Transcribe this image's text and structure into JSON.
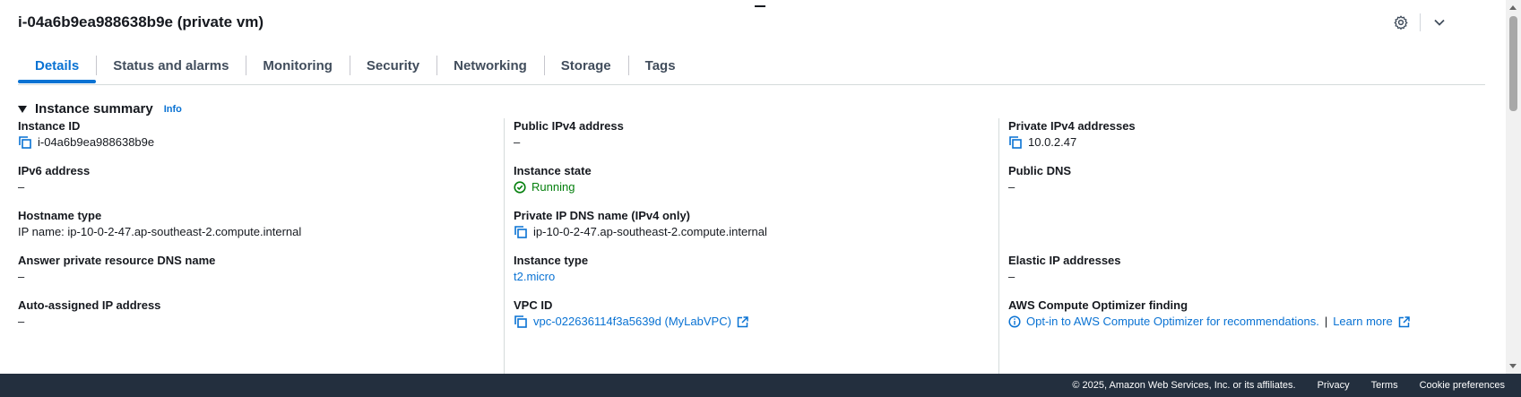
{
  "page": {
    "title": "i-04a6b9ea988638b9e (private vm)"
  },
  "header": {
    "settings_icon": "gear-icon",
    "collapse_icon": "chevron-down-icon"
  },
  "tabs": [
    {
      "label": "Details",
      "active": true
    },
    {
      "label": "Status and alarms"
    },
    {
      "label": "Monitoring"
    },
    {
      "label": "Security"
    },
    {
      "label": "Networking"
    },
    {
      "label": "Storage"
    },
    {
      "label": "Tags"
    }
  ],
  "summary": {
    "title": "Instance summary",
    "info": "Info"
  },
  "fields": {
    "instance_id": {
      "label": "Instance ID",
      "value": "i-04a6b9ea988638b9e"
    },
    "ipv6": {
      "label": "IPv6 address",
      "value": "–"
    },
    "hostname_type": {
      "label": "Hostname type",
      "value": "IP name: ip-10-0-2-47.ap-southeast-2.compute.internal"
    },
    "answer_dns": {
      "label": "Answer private resource DNS name",
      "value": "–"
    },
    "auto_ip": {
      "label": "Auto-assigned IP address",
      "value": "–"
    },
    "public_ipv4": {
      "label": "Public IPv4 address",
      "value": "–"
    },
    "instance_state": {
      "label": "Instance state",
      "value": "Running"
    },
    "private_dns": {
      "label": "Private IP DNS name (IPv4 only)",
      "value": "ip-10-0-2-47.ap-southeast-2.compute.internal"
    },
    "instance_type": {
      "label": "Instance type",
      "value": "t2.micro"
    },
    "vpc_id": {
      "label": "VPC ID",
      "value": "vpc-022636114f3a5639d (MyLabVPC)"
    },
    "private_ipv4": {
      "label": "Private IPv4 addresses",
      "value": "10.0.2.47"
    },
    "public_dns": {
      "label": "Public DNS",
      "value": "–"
    },
    "elastic_ip": {
      "label": "Elastic IP addresses",
      "value": "–"
    },
    "optimizer": {
      "label": "AWS Compute Optimizer finding",
      "value": "Opt-in to AWS Compute Optimizer for recommendations.",
      "separator": "|",
      "learn_more": "Learn more"
    }
  },
  "footer": {
    "copyright": "© 2025, Amazon Web Services, Inc. or its affiliates.",
    "privacy": "Privacy",
    "terms": "Terms",
    "cookies": "Cookie preferences"
  },
  "colors": {
    "accent": "#0972d3",
    "running": "#037f0c",
    "footer_bg": "#232f3e"
  }
}
